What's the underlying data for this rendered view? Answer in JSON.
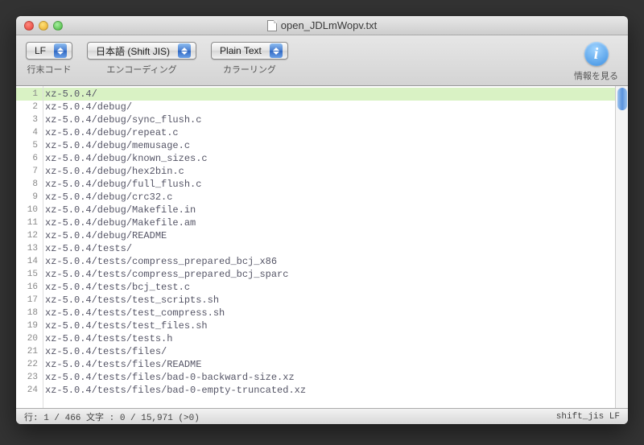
{
  "window": {
    "title": "open_JDLmWopv.txt"
  },
  "toolbar": {
    "lineending": {
      "value": "LF",
      "label": "行末コード"
    },
    "encoding": {
      "value": "日本語 (Shift JIS)",
      "label": "エンコーディング"
    },
    "coloring": {
      "value": "Plain Text",
      "label": "カラーリング"
    },
    "info": {
      "label": "情報を見る",
      "icon": "i"
    }
  },
  "editor": {
    "highlighted_line": 1,
    "lines": [
      "xz-5.0.4/",
      "xz-5.0.4/debug/",
      "xz-5.0.4/debug/sync_flush.c",
      "xz-5.0.4/debug/repeat.c",
      "xz-5.0.4/debug/memusage.c",
      "xz-5.0.4/debug/known_sizes.c",
      "xz-5.0.4/debug/hex2bin.c",
      "xz-5.0.4/debug/full_flush.c",
      "xz-5.0.4/debug/crc32.c",
      "xz-5.0.4/debug/Makefile.in",
      "xz-5.0.4/debug/Makefile.am",
      "xz-5.0.4/debug/README",
      "xz-5.0.4/tests/",
      "xz-5.0.4/tests/compress_prepared_bcj_x86",
      "xz-5.0.4/tests/compress_prepared_bcj_sparc",
      "xz-5.0.4/tests/bcj_test.c",
      "xz-5.0.4/tests/test_scripts.sh",
      "xz-5.0.4/tests/test_compress.sh",
      "xz-5.0.4/tests/test_files.sh",
      "xz-5.0.4/tests/tests.h",
      "xz-5.0.4/tests/files/",
      "xz-5.0.4/tests/files/README",
      "xz-5.0.4/tests/files/bad-0-backward-size.xz",
      "xz-5.0.4/tests/files/bad-0-empty-truncated.xz"
    ]
  },
  "status": {
    "left": "行: 1 / 466  文字 : 0 / 15,971 (>0)",
    "right": "shift_jis LF"
  }
}
